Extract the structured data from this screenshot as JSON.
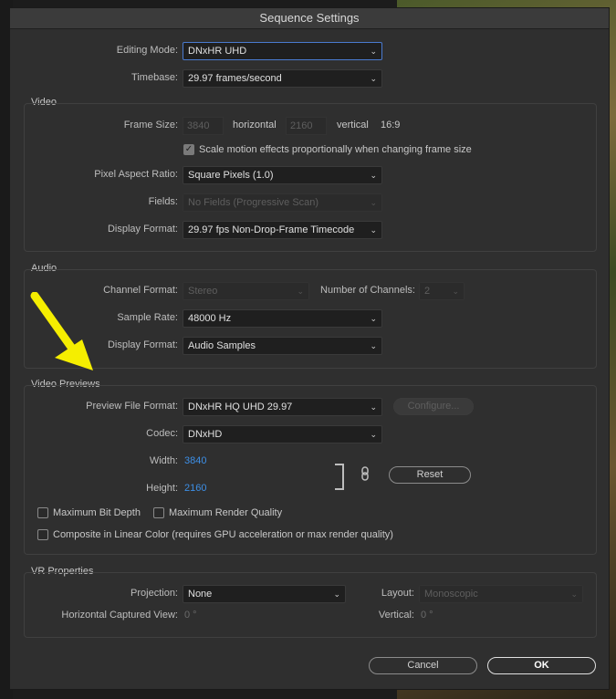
{
  "dialog": {
    "title": "Sequence Settings"
  },
  "top": {
    "editing_mode_label": "Editing Mode:",
    "editing_mode_value": "DNxHR UHD",
    "timebase_label": "Timebase:",
    "timebase_value": "29.97  frames/second"
  },
  "video": {
    "title": "Video",
    "frame_size_label": "Frame Size:",
    "frame_width": "3840",
    "horizontal_label": "horizontal",
    "frame_height": "2160",
    "vertical_label": "vertical",
    "aspect": "16:9",
    "scale_motion_label": "Scale motion effects proportionally when changing frame size",
    "scale_motion_checked": true,
    "pixel_aspect_label": "Pixel Aspect Ratio:",
    "pixel_aspect_value": "Square Pixels (1.0)",
    "fields_label": "Fields:",
    "fields_value": "No Fields (Progressive Scan)",
    "display_format_label": "Display Format:",
    "display_format_value": "29.97 fps Non-Drop-Frame Timecode"
  },
  "audio": {
    "title": "Audio",
    "channel_format_label": "Channel Format:",
    "channel_format_value": "Stereo",
    "num_channels_label": "Number of Channels:",
    "num_channels_value": "2",
    "sample_rate_label": "Sample Rate:",
    "sample_rate_value": "48000 Hz",
    "display_format_label": "Display Format:",
    "display_format_value": "Audio Samples"
  },
  "previews": {
    "title": "Video Previews",
    "file_format_label": "Preview File Format:",
    "file_format_value": "DNxHR HQ UHD 29.97",
    "configure_label": "Configure...",
    "codec_label": "Codec:",
    "codec_value": "DNxHD",
    "width_label": "Width:",
    "width_value": "3840",
    "height_label": "Height:",
    "height_value": "2160",
    "reset_label": "Reset",
    "max_bit_depth_label": "Maximum Bit Depth",
    "max_render_quality_label": "Maximum Render Quality",
    "linear_color_label": "Composite in Linear Color (requires GPU acceleration or max render quality)"
  },
  "vr": {
    "title": "VR Properties",
    "projection_label": "Projection:",
    "projection_value": "None",
    "layout_label": "Layout:",
    "layout_value": "Monoscopic",
    "h_captured_label": "Horizontal Captured View:",
    "h_captured_value": "0 °",
    "vertical_label": "Vertical:",
    "vertical_value": "0 °"
  },
  "buttons": {
    "cancel": "Cancel",
    "ok": "OK"
  },
  "colors": {
    "accent_blue": "#3d8fe6",
    "arrow_yellow": "#f5ee00"
  },
  "icons": {
    "chevron": "chevron-down-icon",
    "link": "link-icon",
    "arrow": "annotation-arrow-icon"
  }
}
